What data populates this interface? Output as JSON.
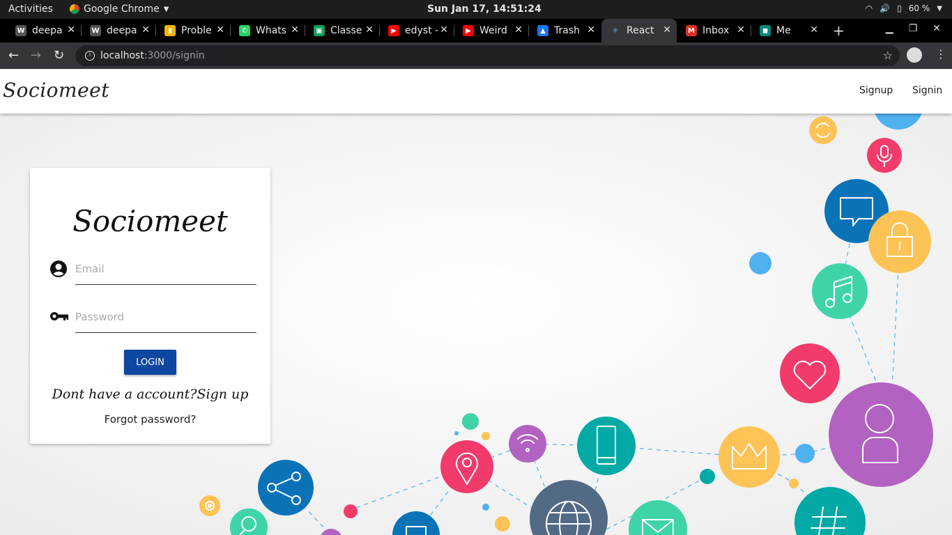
{
  "os": {
    "activities": "Activities",
    "app_name": "Google Chrome",
    "clock": "Sun Jan 17, 14:51:24",
    "battery": "60 %"
  },
  "tabs": [
    {
      "title": "deepa",
      "fav": "W",
      "color": "#555555"
    },
    {
      "title": "deepa",
      "fav": "W",
      "color": "#555555"
    },
    {
      "title": "Proble",
      "fav": "▮",
      "color": "#f4b400"
    },
    {
      "title": "Whats",
      "fav": "✆",
      "color": "#25d366"
    },
    {
      "title": "Classe",
      "fav": "▣",
      "color": "#0f9d58"
    },
    {
      "title": "edyst -",
      "fav": "▶",
      "color": "#ff0000"
    },
    {
      "title": "Weird",
      "fav": "▶",
      "color": "#ff0000"
    },
    {
      "title": "Trash",
      "fav": "▲",
      "color": "#1a73e8"
    },
    {
      "title": "React",
      "fav": "⚛",
      "color": "#35363a"
    },
    {
      "title": "Inbox",
      "fav": "M",
      "color": "#d93025"
    },
    {
      "title": "Me",
      "fav": "◼",
      "color": "#00897b"
    }
  ],
  "address": {
    "host": "localhost",
    "path": ":3000/signin"
  },
  "nav": {
    "brand": "Sociomeet",
    "signup": "Signup",
    "signin": "Signin"
  },
  "card": {
    "title": "Sociomeet",
    "email_placeholder": "Email",
    "password_placeholder": "Password",
    "login_label": "LOGIN",
    "signup_line": "Dont have a account?Sign up",
    "forgot": "Forgot password?"
  },
  "colors": {
    "login_button": "#0d47a1",
    "pink": "#f23b6b",
    "blue": "#0a73b8",
    "yellow": "#fec357",
    "green": "#3fd4a8",
    "purple": "#b262c0",
    "teal": "#03aaa5",
    "slate": "#536a85",
    "sky": "#4fb2ef"
  }
}
